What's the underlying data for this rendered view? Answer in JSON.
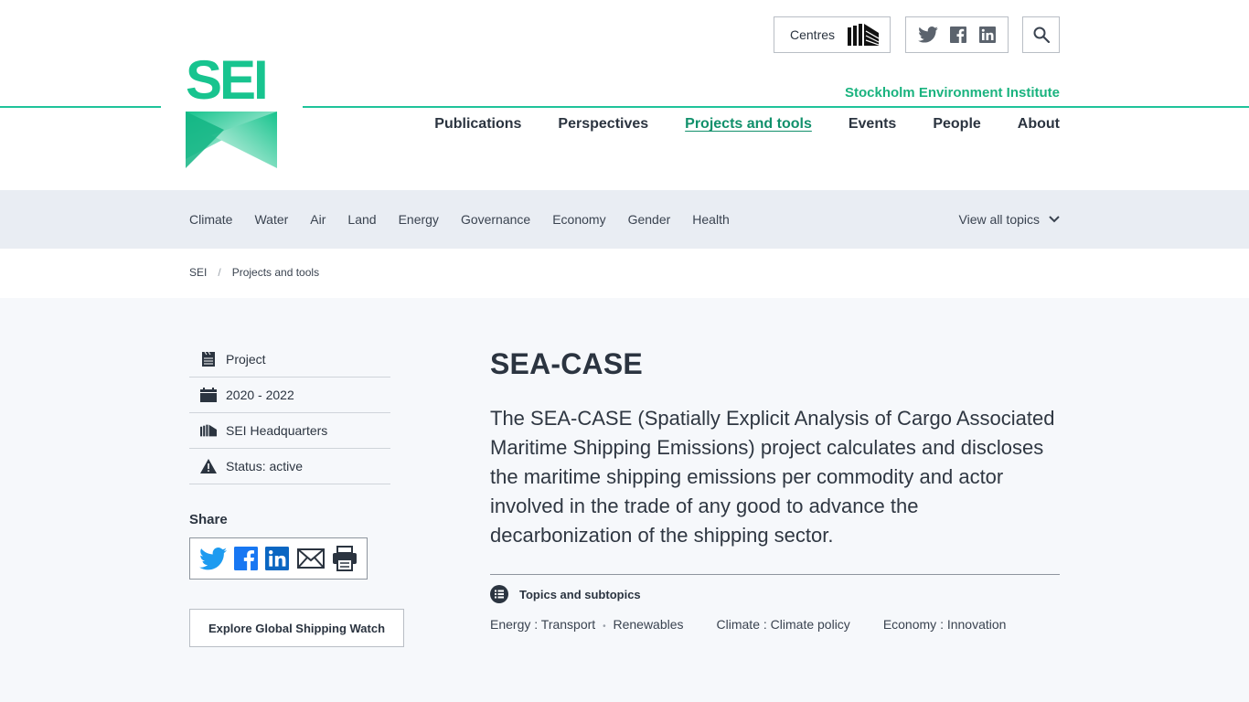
{
  "header": {
    "brand": "SEI",
    "institute": "Stockholm Environment Institute",
    "centres_label": "Centres",
    "nav": [
      "Publications",
      "Perspectives",
      "Projects and tools",
      "Events",
      "People",
      "About"
    ]
  },
  "topic_bar": {
    "topics": [
      "Climate",
      "Water",
      "Air",
      "Land",
      "Energy",
      "Governance",
      "Economy",
      "Gender",
      "Health"
    ],
    "view_all": "View all topics"
  },
  "breadcrumb": {
    "home": "SEI",
    "separator": "/",
    "current": "Projects and tools"
  },
  "sidebar": {
    "meta": [
      "Project",
      "2020 - 2022",
      "SEI Headquarters",
      "Status: active"
    ],
    "share_title": "Share",
    "explore_label": "Explore Global Shipping Watch"
  },
  "main": {
    "title": "SEA-CASE",
    "lead": "The SEA-CASE (Spatially Explicit Analysis of Cargo Associated Maritime Shipping Emissions) project calculates and discloses the maritime shipping emissions per commodity and actor involved in the trade of any good to advance the decarbonization of the shipping sector.",
    "topics_heading": "Topics and subtopics",
    "topic_groups": [
      {
        "topic": "Energy",
        "sep": ":",
        "sub1": "Transport",
        "dot": "•",
        "sub2": "Renewables"
      },
      {
        "topic": "Climate",
        "sep": ":",
        "sub1": "Climate policy"
      },
      {
        "topic": "Economy",
        "sep": ":",
        "sub1": "Innovation"
      }
    ]
  },
  "colors": {
    "brand_green": "#18c48f",
    "active_nav": "#11906b",
    "twitter": "#1d9bf0",
    "facebook": "#1877f2",
    "linkedin": "#0a66c2"
  }
}
